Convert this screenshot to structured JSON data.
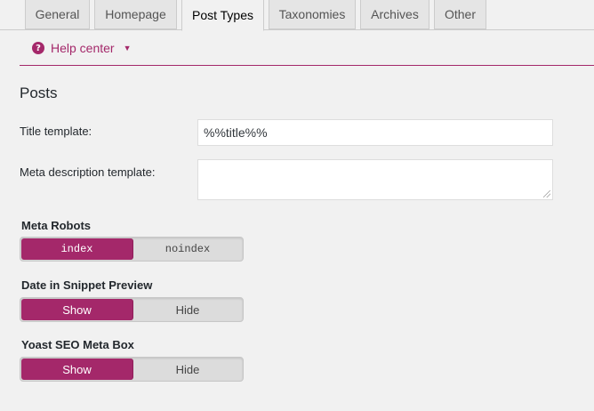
{
  "tabs": [
    {
      "label": "General",
      "active": false
    },
    {
      "label": "Homepage",
      "active": false
    },
    {
      "label": "Post Types",
      "active": true
    },
    {
      "label": "Taxonomies",
      "active": false
    },
    {
      "label": "Archives",
      "active": false
    },
    {
      "label": "Other",
      "active": false
    }
  ],
  "help": {
    "label": "Help center",
    "icon": "question-circle-icon"
  },
  "section": {
    "title": "Posts"
  },
  "fields": {
    "title_template": {
      "label": "Title template:",
      "value": "%%title%%"
    },
    "meta_description": {
      "label": "Meta description template:",
      "value": ""
    }
  },
  "toggles": {
    "meta_robots": {
      "title": "Meta Robots",
      "on": "index",
      "off": "noindex",
      "selected": "index"
    },
    "date_snippet": {
      "title": "Date in Snippet Preview",
      "on": "Show",
      "off": "Hide",
      "selected": "Show"
    },
    "meta_box": {
      "title": "Yoast SEO Meta Box",
      "on": "Show",
      "off": "Hide",
      "selected": "Show"
    }
  },
  "colors": {
    "accent": "#a4286a",
    "background": "#f1f1f1"
  }
}
